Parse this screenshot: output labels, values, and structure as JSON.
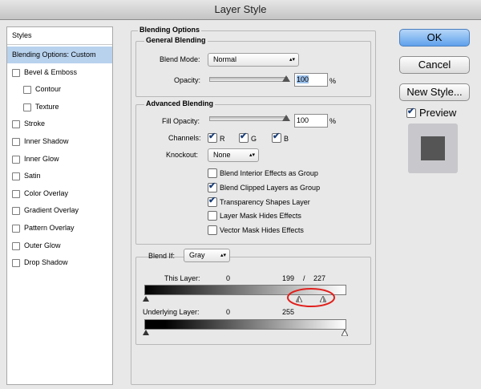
{
  "window": {
    "title": "Layer Style"
  },
  "sidebar": {
    "header": "Styles",
    "items": [
      {
        "label": "Blending Options: Custom",
        "selected": true,
        "has_checkbox": false,
        "indent": 0
      },
      {
        "label": "Bevel & Emboss",
        "has_checkbox": true,
        "indent": 0
      },
      {
        "label": "Contour",
        "has_checkbox": true,
        "indent": 1
      },
      {
        "label": "Texture",
        "has_checkbox": true,
        "indent": 1
      },
      {
        "label": "Stroke",
        "has_checkbox": true,
        "indent": 0
      },
      {
        "label": "Inner Shadow",
        "has_checkbox": true,
        "indent": 0
      },
      {
        "label": "Inner Glow",
        "has_checkbox": true,
        "indent": 0
      },
      {
        "label": "Satin",
        "has_checkbox": true,
        "indent": 0
      },
      {
        "label": "Color Overlay",
        "has_checkbox": true,
        "indent": 0
      },
      {
        "label": "Gradient Overlay",
        "has_checkbox": true,
        "indent": 0
      },
      {
        "label": "Pattern Overlay",
        "has_checkbox": true,
        "indent": 0
      },
      {
        "label": "Outer Glow",
        "has_checkbox": true,
        "indent": 0
      },
      {
        "label": "Drop Shadow",
        "has_checkbox": true,
        "indent": 0
      }
    ]
  },
  "blending": {
    "title": "Blending Options",
    "general": {
      "title": "General Blending",
      "mode_label": "Blend Mode:",
      "mode_value": "Normal",
      "opacity_label": "Opacity:",
      "opacity_value": "100",
      "opacity_unit": "%",
      "opacity_level": 1.0
    },
    "advanced": {
      "title": "Advanced Blending",
      "fill_label": "Fill Opacity:",
      "fill_value": "100",
      "fill_unit": "%",
      "fill_level": 1.0,
      "channels_label": "Channels:",
      "channels": [
        {
          "label": "R",
          "checked": true
        },
        {
          "label": "G",
          "checked": true
        },
        {
          "label": "B",
          "checked": true
        }
      ],
      "knockout_label": "Knockout:",
      "knockout_value": "None",
      "options": [
        {
          "label": "Blend Interior Effects as Group",
          "checked": false
        },
        {
          "label": "Blend Clipped Layers as Group",
          "checked": true
        },
        {
          "label": "Transparency Shapes Layer",
          "checked": true
        },
        {
          "label": "Layer Mask Hides Effects",
          "checked": false
        },
        {
          "label": "Vector Mask Hides Effects",
          "checked": false
        }
      ]
    },
    "blend_if": {
      "label": "Blend If:",
      "value": "Gray",
      "this_layer": {
        "label": "This Layer:",
        "low": "0",
        "high_a": "199",
        "sep": "/",
        "high_b": "227"
      },
      "underlying": {
        "label": "Underlying Layer:",
        "low": "0",
        "high": "255"
      }
    }
  },
  "buttons": {
    "ok": "OK",
    "cancel": "Cancel",
    "new_style": "New Style..."
  },
  "preview": {
    "label": "Preview",
    "checked": true,
    "swatch_color": "#555555",
    "frame_color": "#c7c7cc"
  },
  "highlight_color": "#e0201c"
}
